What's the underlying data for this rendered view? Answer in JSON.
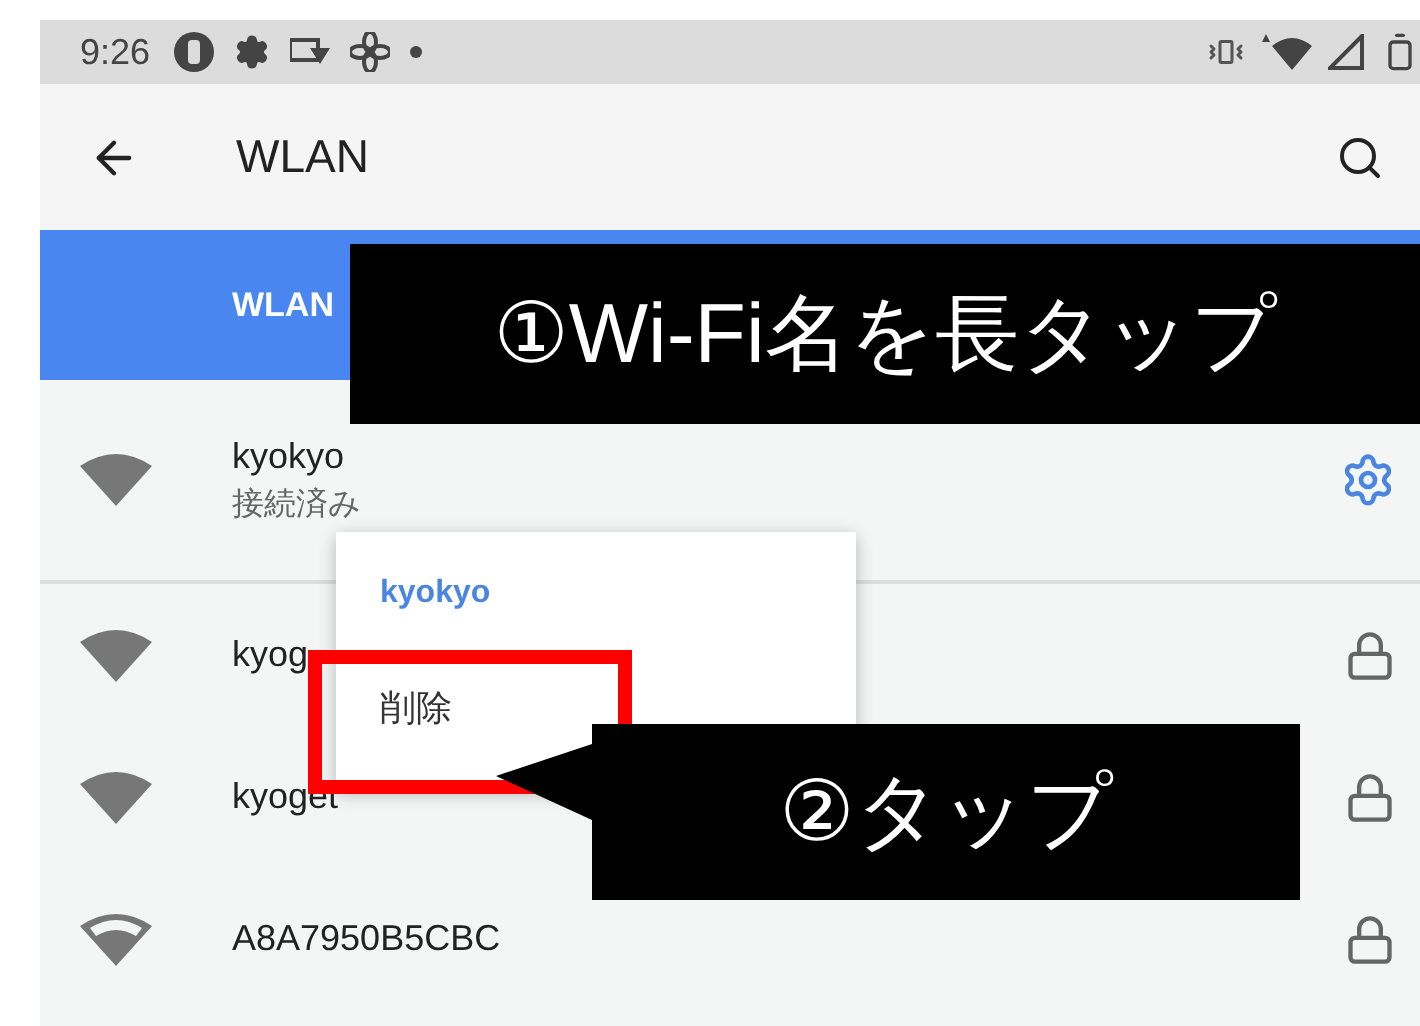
{
  "status_bar": {
    "time": "9:26"
  },
  "app_bar": {
    "title": "WLAN"
  },
  "switch_bar": {
    "label": "WLAN"
  },
  "networks": [
    {
      "name": "kyokyo",
      "status": "接続済み",
      "kind": "connected"
    },
    {
      "name": "kyog",
      "kind": "secured"
    },
    {
      "name": "kyoget",
      "kind": "secured"
    },
    {
      "name": "A8A7950B5CBC",
      "kind": "weak"
    }
  ],
  "context_menu": {
    "title": "kyokyo",
    "items": [
      "削除"
    ]
  },
  "annotations": [
    {
      "kind": "banner",
      "text": "①Wi-Fi名を長タップ"
    },
    {
      "kind": "callout",
      "text": "②タップ"
    }
  ]
}
